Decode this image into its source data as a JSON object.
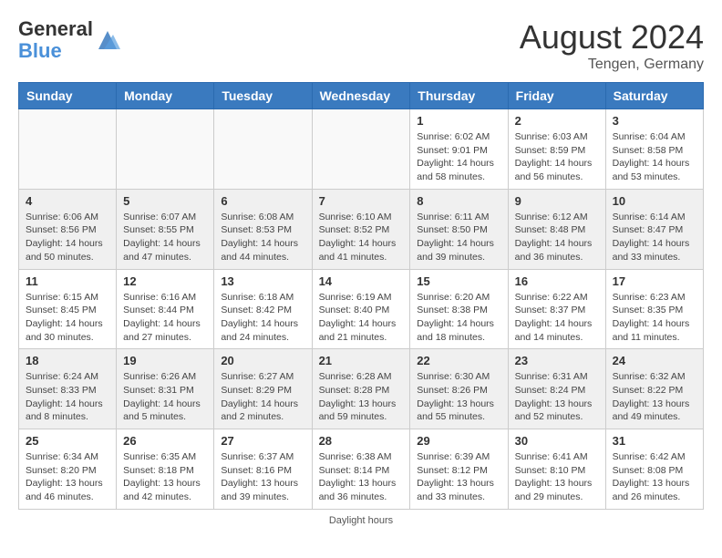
{
  "header": {
    "logo_general": "General",
    "logo_blue": "Blue",
    "month_year": "August 2024",
    "location": "Tengen, Germany"
  },
  "days_of_week": [
    "Sunday",
    "Monday",
    "Tuesday",
    "Wednesday",
    "Thursday",
    "Friday",
    "Saturday"
  ],
  "weeks": [
    {
      "shaded": false,
      "days": [
        {
          "date": "",
          "info": ""
        },
        {
          "date": "",
          "info": ""
        },
        {
          "date": "",
          "info": ""
        },
        {
          "date": "",
          "info": ""
        },
        {
          "date": "1",
          "info": "Sunrise: 6:02 AM\nSunset: 9:01 PM\nDaylight: 14 hours and 58 minutes."
        },
        {
          "date": "2",
          "info": "Sunrise: 6:03 AM\nSunset: 8:59 PM\nDaylight: 14 hours and 56 minutes."
        },
        {
          "date": "3",
          "info": "Sunrise: 6:04 AM\nSunset: 8:58 PM\nDaylight: 14 hours and 53 minutes."
        }
      ]
    },
    {
      "shaded": true,
      "days": [
        {
          "date": "4",
          "info": "Sunrise: 6:06 AM\nSunset: 8:56 PM\nDaylight: 14 hours and 50 minutes."
        },
        {
          "date": "5",
          "info": "Sunrise: 6:07 AM\nSunset: 8:55 PM\nDaylight: 14 hours and 47 minutes."
        },
        {
          "date": "6",
          "info": "Sunrise: 6:08 AM\nSunset: 8:53 PM\nDaylight: 14 hours and 44 minutes."
        },
        {
          "date": "7",
          "info": "Sunrise: 6:10 AM\nSunset: 8:52 PM\nDaylight: 14 hours and 41 minutes."
        },
        {
          "date": "8",
          "info": "Sunrise: 6:11 AM\nSunset: 8:50 PM\nDaylight: 14 hours and 39 minutes."
        },
        {
          "date": "9",
          "info": "Sunrise: 6:12 AM\nSunset: 8:48 PM\nDaylight: 14 hours and 36 minutes."
        },
        {
          "date": "10",
          "info": "Sunrise: 6:14 AM\nSunset: 8:47 PM\nDaylight: 14 hours and 33 minutes."
        }
      ]
    },
    {
      "shaded": false,
      "days": [
        {
          "date": "11",
          "info": "Sunrise: 6:15 AM\nSunset: 8:45 PM\nDaylight: 14 hours and 30 minutes."
        },
        {
          "date": "12",
          "info": "Sunrise: 6:16 AM\nSunset: 8:44 PM\nDaylight: 14 hours and 27 minutes."
        },
        {
          "date": "13",
          "info": "Sunrise: 6:18 AM\nSunset: 8:42 PM\nDaylight: 14 hours and 24 minutes."
        },
        {
          "date": "14",
          "info": "Sunrise: 6:19 AM\nSunset: 8:40 PM\nDaylight: 14 hours and 21 minutes."
        },
        {
          "date": "15",
          "info": "Sunrise: 6:20 AM\nSunset: 8:38 PM\nDaylight: 14 hours and 18 minutes."
        },
        {
          "date": "16",
          "info": "Sunrise: 6:22 AM\nSunset: 8:37 PM\nDaylight: 14 hours and 14 minutes."
        },
        {
          "date": "17",
          "info": "Sunrise: 6:23 AM\nSunset: 8:35 PM\nDaylight: 14 hours and 11 minutes."
        }
      ]
    },
    {
      "shaded": true,
      "days": [
        {
          "date": "18",
          "info": "Sunrise: 6:24 AM\nSunset: 8:33 PM\nDaylight: 14 hours and 8 minutes."
        },
        {
          "date": "19",
          "info": "Sunrise: 6:26 AM\nSunset: 8:31 PM\nDaylight: 14 hours and 5 minutes."
        },
        {
          "date": "20",
          "info": "Sunrise: 6:27 AM\nSunset: 8:29 PM\nDaylight: 14 hours and 2 minutes."
        },
        {
          "date": "21",
          "info": "Sunrise: 6:28 AM\nSunset: 8:28 PM\nDaylight: 13 hours and 59 minutes."
        },
        {
          "date": "22",
          "info": "Sunrise: 6:30 AM\nSunset: 8:26 PM\nDaylight: 13 hours and 55 minutes."
        },
        {
          "date": "23",
          "info": "Sunrise: 6:31 AM\nSunset: 8:24 PM\nDaylight: 13 hours and 52 minutes."
        },
        {
          "date": "24",
          "info": "Sunrise: 6:32 AM\nSunset: 8:22 PM\nDaylight: 13 hours and 49 minutes."
        }
      ]
    },
    {
      "shaded": false,
      "days": [
        {
          "date": "25",
          "info": "Sunrise: 6:34 AM\nSunset: 8:20 PM\nDaylight: 13 hours and 46 minutes."
        },
        {
          "date": "26",
          "info": "Sunrise: 6:35 AM\nSunset: 8:18 PM\nDaylight: 13 hours and 42 minutes."
        },
        {
          "date": "27",
          "info": "Sunrise: 6:37 AM\nSunset: 8:16 PM\nDaylight: 13 hours and 39 minutes."
        },
        {
          "date": "28",
          "info": "Sunrise: 6:38 AM\nSunset: 8:14 PM\nDaylight: 13 hours and 36 minutes."
        },
        {
          "date": "29",
          "info": "Sunrise: 6:39 AM\nSunset: 8:12 PM\nDaylight: 13 hours and 33 minutes."
        },
        {
          "date": "30",
          "info": "Sunrise: 6:41 AM\nSunset: 8:10 PM\nDaylight: 13 hours and 29 minutes."
        },
        {
          "date": "31",
          "info": "Sunrise: 6:42 AM\nSunset: 8:08 PM\nDaylight: 13 hours and 26 minutes."
        }
      ]
    }
  ],
  "footer": {
    "note": "Daylight hours"
  }
}
